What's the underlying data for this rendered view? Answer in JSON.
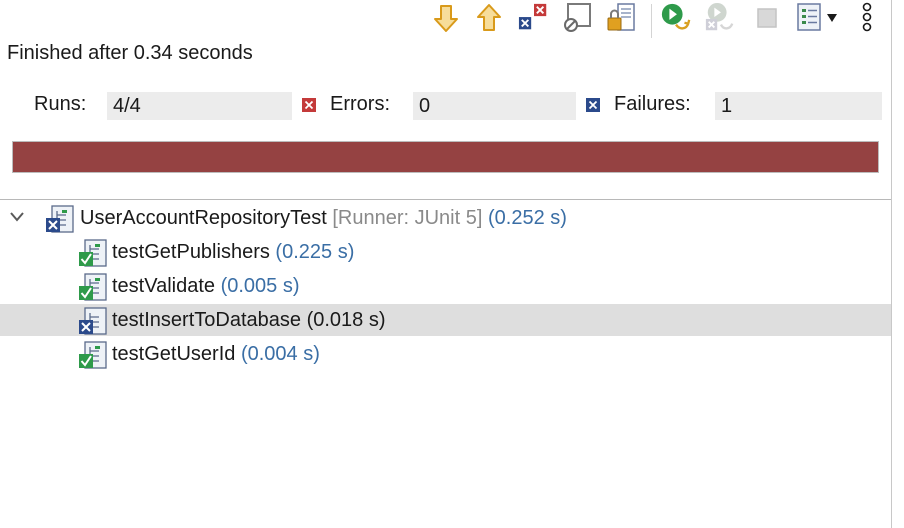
{
  "toolbar": {
    "buttons": [
      {
        "name": "next-failure-icon"
      },
      {
        "name": "previous-failure-icon"
      },
      {
        "name": "show-failures-only-icon"
      },
      {
        "name": "show-skipped-only-icon"
      },
      {
        "name": "scroll-lock-icon"
      },
      {
        "name": "rerun-test-icon"
      },
      {
        "name": "rerun-failed-first-icon"
      },
      {
        "name": "stop-icon"
      },
      {
        "name": "test-run-history-icon"
      },
      {
        "name": "history-dropdown-icon"
      },
      {
        "name": "more-options-icon"
      }
    ]
  },
  "status": {
    "text": "Finished after 0.34 seconds"
  },
  "counters": {
    "runs_label": "Runs:",
    "runs_value": "4/4",
    "errors_label": "Errors:",
    "errors_value": "0",
    "failures_label": "Failures:",
    "failures_value": "1"
  },
  "progress": {
    "fraction": 1.0,
    "color": "#954242"
  },
  "colors": {
    "time_blue": "#3a6ea5",
    "runner_gray": "#8a8a8a",
    "selected_row": "#dedede"
  },
  "tree": {
    "root": {
      "name": "UserAccountRepositoryTest",
      "runner": "[Runner: JUnit 5]",
      "time": "(0.252 s)",
      "status": "failure",
      "expanded": true
    },
    "items": [
      {
        "name": "testGetPublishers",
        "time": "(0.225 s)",
        "status": "passed"
      },
      {
        "name": "testValidate",
        "time": "(0.005 s)",
        "status": "passed"
      },
      {
        "name": "testInsertToDatabase",
        "time": "(0.018 s)",
        "status": "failure"
      },
      {
        "name": "testGetUserId",
        "time": "(0.004 s)",
        "status": "passed"
      }
    ]
  }
}
